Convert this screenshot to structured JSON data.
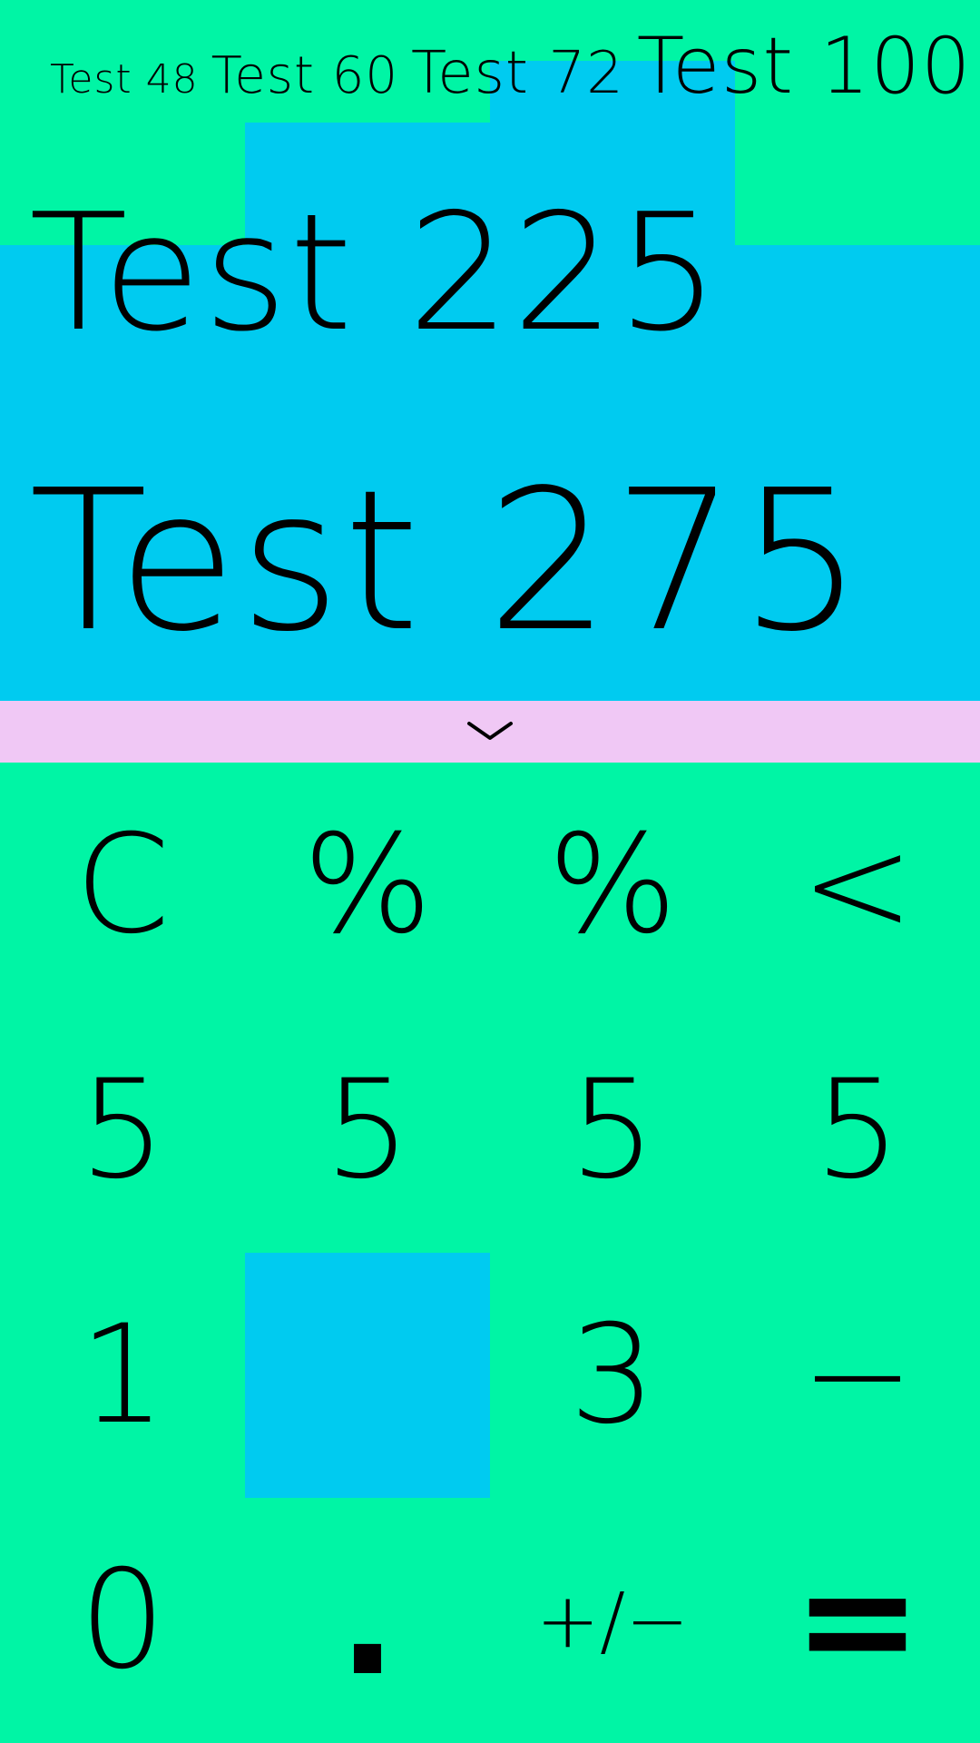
{
  "samples": {
    "t48": "Test 48",
    "t60": "Test 60",
    "t72": "Test 72",
    "t100": "Test 100"
  },
  "display": {
    "line1": "Test 225",
    "line2": "Test 275"
  },
  "expand": {
    "icon": "chevron-down-icon"
  },
  "keypad": {
    "row1": [
      "C",
      "%",
      "%",
      "<"
    ],
    "row2": [
      "5",
      "5",
      "5",
      "5"
    ],
    "row3": [
      "1",
      "",
      "3",
      "−"
    ],
    "row4": [
      "0",
      ".",
      "+/−",
      "="
    ]
  },
  "colors": {
    "background": "#00f5a5",
    "display_block": "#00cbf0",
    "expand_bar": "#f0c8f5",
    "text": "#000000"
  }
}
